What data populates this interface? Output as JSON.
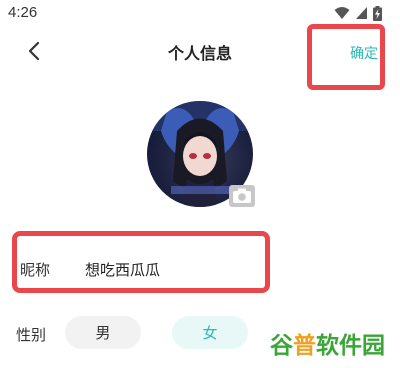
{
  "status_bar": {
    "time": "4:26",
    "icons": [
      "wifi-icon",
      "signal-icon",
      "battery-charging-icon"
    ]
  },
  "header": {
    "back_icon": "chevron-left-icon",
    "title": "个人信息",
    "confirm_label": "确定"
  },
  "avatar": {
    "badge_icon": "camera-icon"
  },
  "form": {
    "nickname_label": "昵称",
    "nickname_value": "想吃西瓜瓜",
    "gender_label": "性别",
    "gender_options": [
      "男",
      "女"
    ],
    "gender_selected": "女"
  },
  "watermark": {
    "text": "谷普软件园"
  },
  "colors": {
    "accent": "#2bb9b3",
    "highlight_border": "#e9474c",
    "watermark_green": "#3aa637",
    "watermark_orange": "#f0a020"
  }
}
